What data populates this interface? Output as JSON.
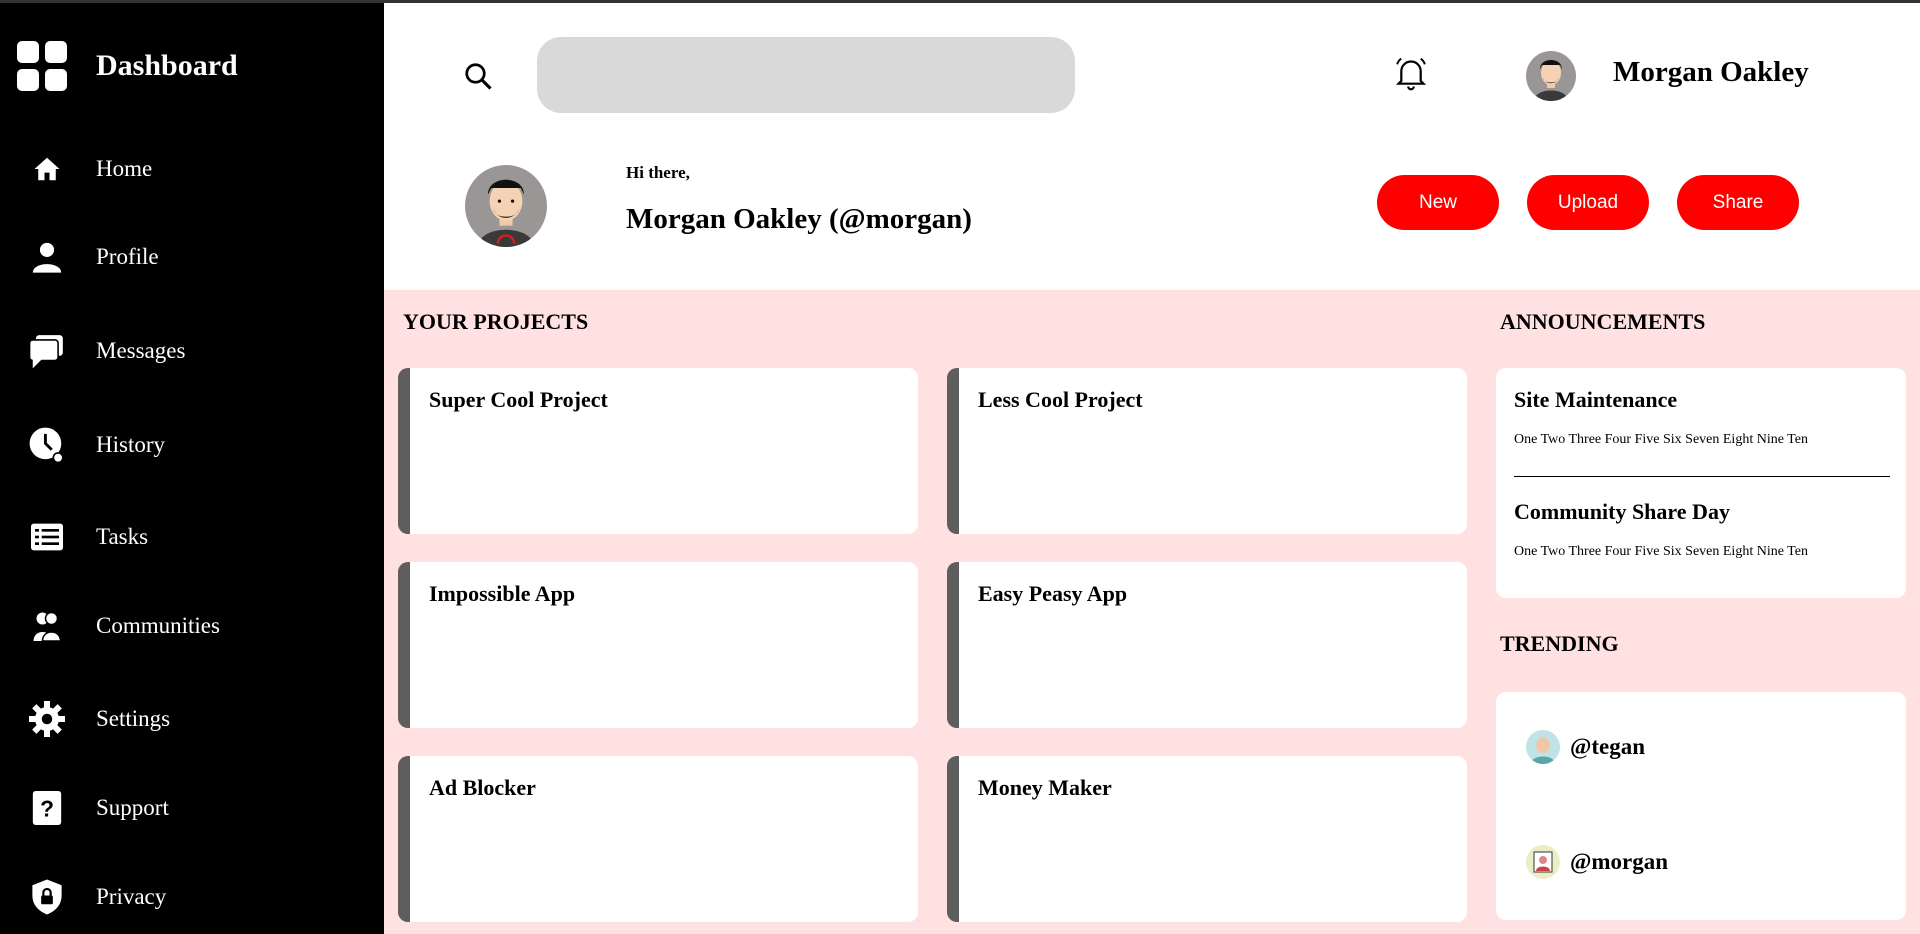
{
  "sidebar": {
    "title": "Dashboard",
    "items": [
      {
        "label": "Home",
        "icon": "home-icon"
      },
      {
        "label": "Profile",
        "icon": "user-icon"
      },
      {
        "label": "Messages",
        "icon": "chat-icon"
      },
      {
        "label": "History",
        "icon": "clock-icon"
      },
      {
        "label": "Tasks",
        "icon": "list-icon"
      },
      {
        "label": "Communities",
        "icon": "users-icon"
      },
      {
        "label": "Settings",
        "icon": "gear-icon"
      },
      {
        "label": "Support",
        "icon": "help-icon"
      },
      {
        "label": "Privacy",
        "icon": "shield-lock-icon"
      }
    ]
  },
  "header": {
    "search_placeholder": "",
    "user_name": "Morgan Oakley"
  },
  "greeting": {
    "hi": "Hi there,",
    "name": "Morgan Oakley (@morgan)"
  },
  "actions": {
    "new_label": "New",
    "upload_label": "Upload",
    "share_label": "Share"
  },
  "projects": {
    "title": "YOUR PROJECTS",
    "items": [
      "Super Cool Project",
      "Less Cool Project",
      "Impossible App",
      "Easy Peasy App",
      "Ad Blocker",
      "Money Maker"
    ]
  },
  "announcements": {
    "title": "ANNOUNCEMENTS",
    "items": [
      {
        "title": "Site Maintenance",
        "body": "One Two Three Four Five Six Seven Eight Nine Ten"
      },
      {
        "title": "Community Share Day",
        "body": "One Two Three Four Five Six Seven Eight Nine Ten"
      }
    ]
  },
  "trending": {
    "title": "TRENDING",
    "items": [
      {
        "handle": "@tegan"
      },
      {
        "handle": "@morgan"
      }
    ]
  },
  "colors": {
    "accent": "#ff0000",
    "main_bg": "#ffe1e1",
    "sidebar_bg": "#000000",
    "card_border": "#5e5e5e",
    "search_bg": "#d9d9d9"
  }
}
